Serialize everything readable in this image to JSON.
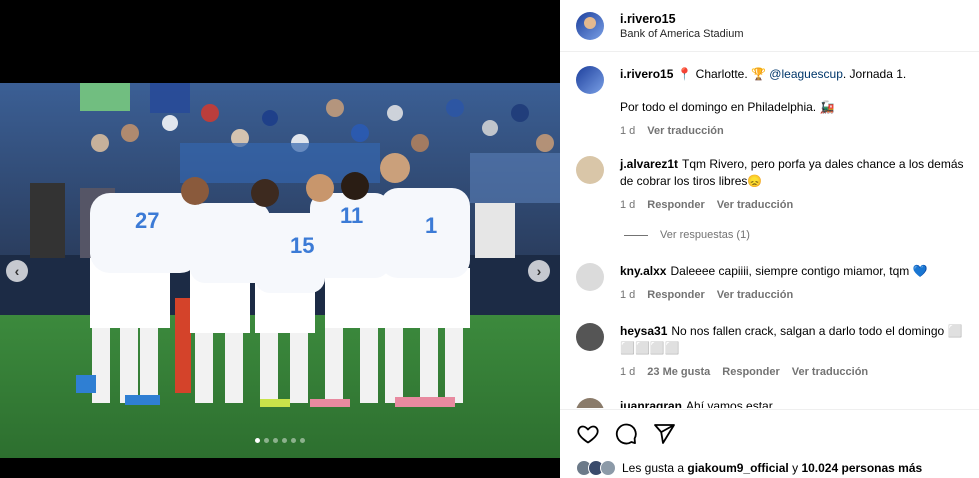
{
  "post": {
    "username": "i.rivero15",
    "location": "Bank of America Stadium"
  },
  "caption": {
    "username": "i.rivero15",
    "text_before": "📍 Charlotte. 🏆 ",
    "mention": "@leaguescup",
    "text_after": ". Jornada 1.",
    "line2": "Por todo el domingo en Philadelphia. 🚂",
    "time": "1 d",
    "translate": "Ver traducción"
  },
  "comments": [
    {
      "username": "j.alvarez1t",
      "text": "Tqm Rivero, pero porfa ya dales chance a los demás de cobrar los tiros libres😞",
      "time": "1 d",
      "reply": "Responder",
      "translate": "Ver traducción"
    },
    {
      "username": "kny.alxx",
      "text": "Daleeee capiiii, siempre contigo miamor, tqm 💙",
      "time": "1 d",
      "reply": "Responder",
      "translate": "Ver traducción"
    },
    {
      "username": "heysa31",
      "text": "No nos fallen crack, salgan a darlo todo el domingo ⬜ ⬜⬜⬜⬜",
      "time": "1 d",
      "likes": "23 Me gusta",
      "reply": "Responder",
      "translate": "Ver traducción"
    },
    {
      "username": "juanragran",
      "text": "Ahí vamos estar"
    }
  ],
  "view_replies": "Ver respuestas (1)",
  "likes_summary": {
    "prefix": "Les gusta a",
    "user": "giakoum9_official",
    "middle": "y",
    "count": "10.024 personas más"
  },
  "media": {
    "slide_count": 6,
    "active_slide": 1,
    "prev_icon": "chevron-left-icon",
    "next_icon": "chevron-right-icon"
  },
  "colors": {
    "jersey": "#f4f6fa",
    "jersey_accent": "#3c7bd6",
    "pitch": "#2f7b36",
    "stands": "#2b4f87"
  }
}
